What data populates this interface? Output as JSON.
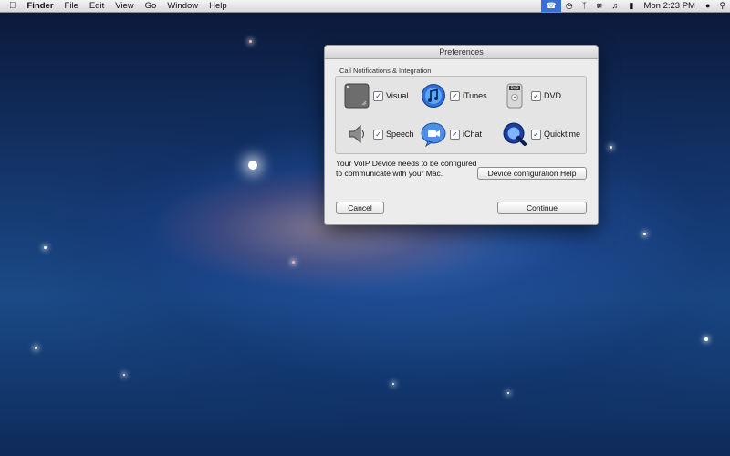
{
  "menubar": {
    "app_name": "Finder",
    "menus": [
      "File",
      "Edit",
      "View",
      "Go",
      "Window",
      "Help"
    ],
    "clock": "Mon 2:23 PM"
  },
  "window": {
    "title": "Preferences",
    "group_label": "Call Notifications & Integration",
    "options": [
      {
        "label": "Visual",
        "checked": true,
        "icon": "visual-icon"
      },
      {
        "label": "iTunes",
        "checked": true,
        "icon": "itunes-icon"
      },
      {
        "label": "DVD",
        "checked": true,
        "icon": "dvd-icon"
      },
      {
        "label": "Speech",
        "checked": true,
        "icon": "speech-icon"
      },
      {
        "label": "iChat",
        "checked": true,
        "icon": "ichat-icon"
      },
      {
        "label": "Quicktime",
        "checked": true,
        "icon": "quicktime-icon"
      }
    ],
    "message": "Your VoIP Device needs to be configured to communicate with your Mac.",
    "help_button": "Device configuration Help",
    "cancel_button": "Cancel",
    "continue_button": "Continue"
  }
}
